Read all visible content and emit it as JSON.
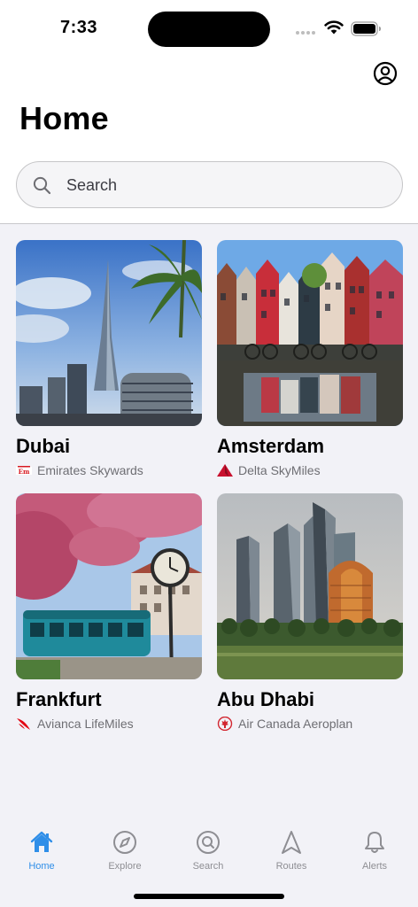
{
  "status_bar": {
    "time": "7:33"
  },
  "page": {
    "title": "Home"
  },
  "search": {
    "placeholder": "Search"
  },
  "destinations": [
    {
      "city": "Dubai",
      "program": "Emirates Skywards",
      "program_logo": "emirates-logo"
    },
    {
      "city": "Amsterdam",
      "program": "Delta SkyMiles",
      "program_logo": "delta-logo"
    },
    {
      "city": "Frankfurt",
      "program": "Avianca LifeMiles",
      "program_logo": "avianca-logo"
    },
    {
      "city": "Abu Dhabi",
      "program": "Air Canada Aeroplan",
      "program_logo": "air-canada-logo"
    }
  ],
  "tabbar": {
    "active": "Home",
    "tabs": [
      {
        "label": "Home",
        "icon": "house-icon"
      },
      {
        "label": "Explore",
        "icon": "compass-icon"
      },
      {
        "label": "Search",
        "icon": "magnifier-icon"
      },
      {
        "label": "Routes",
        "icon": "navigation-arrow-icon"
      },
      {
        "label": "Alerts",
        "icon": "bell-icon"
      }
    ]
  },
  "colors": {
    "accent": "#2f8ee8",
    "inactive": "#8e8e93",
    "background": "#f2f2f7",
    "delta": "#c8102e",
    "emirates": "#d71921",
    "avianca": "#e30613",
    "air_canada": "#d22630"
  }
}
